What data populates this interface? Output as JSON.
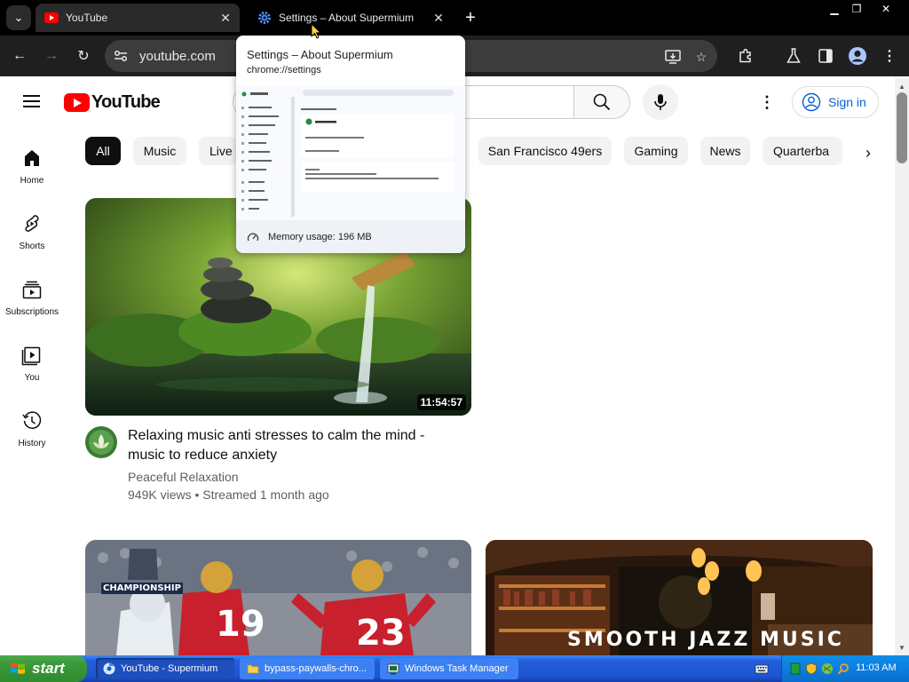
{
  "browser": {
    "tabs": [
      {
        "title": "YouTube"
      },
      {
        "title": "Settings – About Supermium"
      }
    ],
    "address": "youtube.com"
  },
  "hovercard": {
    "title": "Settings – About Supermium",
    "url": "chrome://settings",
    "memory": "Memory usage: 196 MB"
  },
  "youtube": {
    "logo_text": "YouTube",
    "sign_in": "Sign in",
    "chips": [
      "All",
      "Music",
      "Live",
      "San Francisco 49ers",
      "Gaming",
      "News",
      "Quarterba"
    ],
    "sidebar": [
      {
        "label": "Home"
      },
      {
        "label": "Shorts"
      },
      {
        "label": "Subscriptions"
      },
      {
        "label": "You"
      },
      {
        "label": "History"
      }
    ],
    "video1": {
      "title": "Relaxing music anti stresses to calm the mind - music to reduce anxiety",
      "channel": "Peaceful Relaxation",
      "meta": "949K views • Streamed 1 month ago",
      "duration": "11:54:57"
    },
    "video2": {
      "thumb_text": "CHAMPIONSHIP",
      "jersey1": "19",
      "jersey2": "23"
    },
    "video3": {
      "thumb_text": "SMOOTH JAZZ MUSIC"
    }
  },
  "taskbar": {
    "start": "start",
    "tasks": [
      "YouTube - Supermium",
      "bypass-paywalls-chro...",
      "Windows Task Manager"
    ],
    "clock": "11:03 AM"
  },
  "colors": {
    "accent": "#ff0000",
    "link": "#065fd4",
    "browser_dark": "#1f1f1f"
  }
}
